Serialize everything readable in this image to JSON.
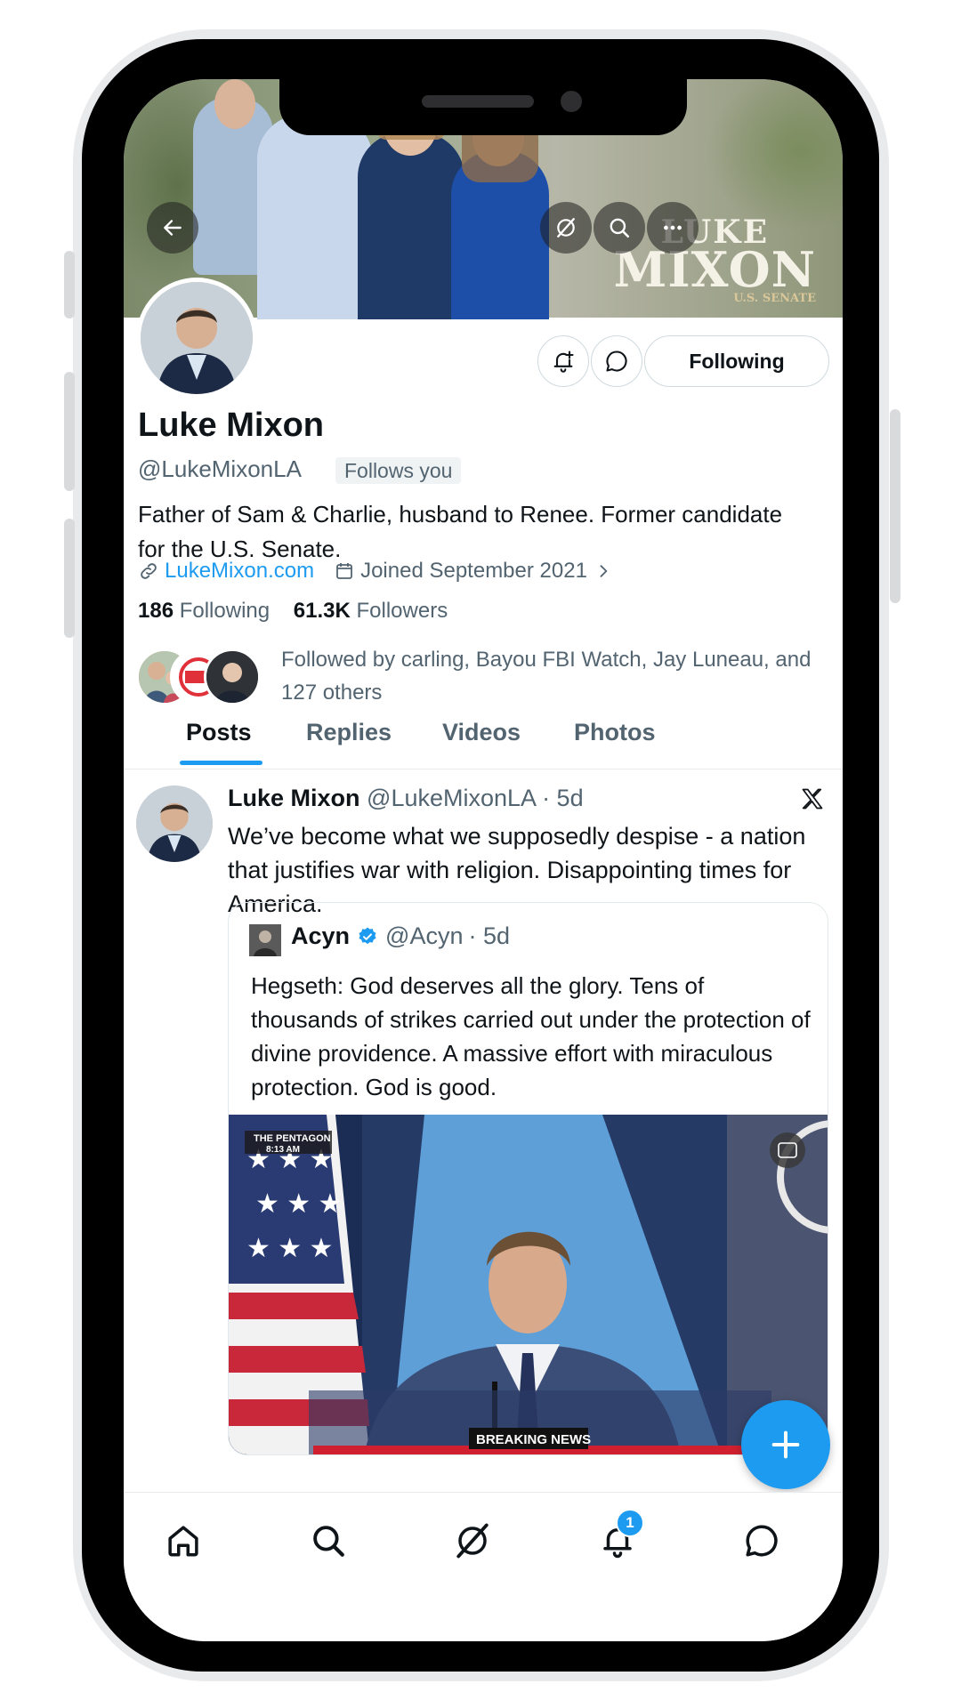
{
  "profile": {
    "name": "Luke Mixon",
    "handle": "@LukeMixonLA",
    "follows_you": "Follows you",
    "bio": "Father of Sam & Charlie, husband to Renee. Former candidate for the U.S. Senate.",
    "website": "LukeMixon.com",
    "joined": "Joined September 2021",
    "following_count": "186",
    "following_label": "Following",
    "followers_count": "61.3K",
    "followers_label": "Followers",
    "followed_by": "Followed by carling, Bayou FBI Watch, Jay Luneau, and 127 others"
  },
  "banner": {
    "logo_line1": "LUKE",
    "logo_line2": "MIXON",
    "logo_line3": "U.S. SENATE"
  },
  "actions": {
    "following_button": "Following"
  },
  "tabs": [
    {
      "label": "Posts",
      "active": true
    },
    {
      "label": "Replies",
      "active": false
    },
    {
      "label": "Videos",
      "active": false
    },
    {
      "label": "Photos",
      "active": false
    }
  ],
  "post": {
    "author": "Luke Mixon",
    "handle": "@LukeMixonLA",
    "time": "· 5d",
    "text": "We’ve become what we supposedly despise - a nation that justifies war with religion. Disappointing times for America.",
    "quote": {
      "author": "Acyn",
      "handle": "@Acyn",
      "time": "· 5d",
      "text": "Hegseth: God deserves all the glory. Tens of thousands of strikes carried out under the protection of divine providence. A massive effort with miraculous protection. God is good.",
      "video_label_1": "THE PENTAGON",
      "video_label_2": "8:13 AM",
      "video_banner": "BREAKING NEWS"
    }
  },
  "nav": {
    "items": [
      "home-icon",
      "search-icon",
      "grok-icon",
      "bell-icon",
      "messages-icon"
    ],
    "notification_count": "1"
  },
  "colors": {
    "accent": "#1d9bf0",
    "text": "#0f1419",
    "secondary_text": "#536471"
  }
}
